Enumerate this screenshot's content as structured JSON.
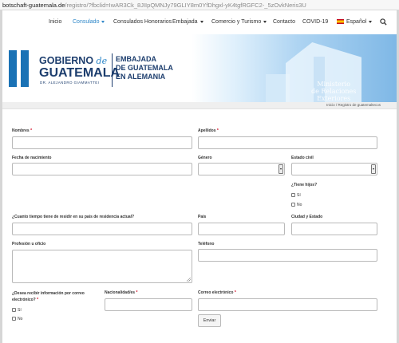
{
  "browser": {
    "url_domain": "botschaft-guatemala.de",
    "url_rest": "/registro/?fbclid=IwAR3Ck_8JIIpQMNJy79GLIY8m0YfDhgxl-yK4tgfRGFC2-_5zOvkNeris3U"
  },
  "nav": {
    "items": [
      "Inicio",
      "Consulado",
      "Consulados Honorarios",
      "Embajada",
      "Comercio y Turismo",
      "Contacto",
      "COVID-19"
    ],
    "language": "Español",
    "accent": "#2c86c8"
  },
  "banner": {
    "gob_line": "GOBIERNO",
    "de": "de",
    "guatemala": "GUATEMALA",
    "dr_name": "DR. ALEJANDRO GIAMMATTEI",
    "embassy_lines": [
      "EMBAJADA",
      "DE GUATEMALA",
      "EN ALEMANIA"
    ],
    "ministerio": "Ministerio\nde Relaciones\nExteriores",
    "brand_color": "#1d3e6e"
  },
  "breadcrumb": {
    "home": "Inicio",
    "sep": "/",
    "current": "Registro de guatemaltecos"
  },
  "form": {
    "nombres": "Nombres",
    "apellidos": "Apellidos",
    "fecha": "Fecha de nacimiento",
    "genero": "Género",
    "estado_civil": "Estado civil",
    "hijos": "¿Tiene hijos?",
    "si": "Sí",
    "no": "No",
    "tiempo": "¿Cuanto tiempo tiene de residir en su país de residencia actual?",
    "pais": "País",
    "ciudad": "Ciudad y Estado",
    "profesion": "Profesión u oficio",
    "telefono": "Teléfono",
    "recibir_1": "¿Desea recibir información por correo",
    "recibir_2": "electrónico?",
    "nacionalidad": "Nacionalidad/es",
    "correo": "Correo electrónico",
    "required_mark": "*",
    "submit": "Enviar"
  }
}
